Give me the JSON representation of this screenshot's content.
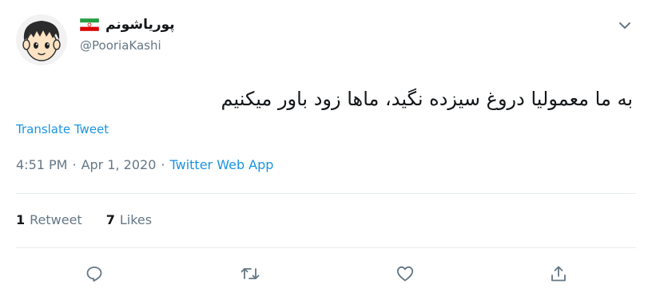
{
  "author": {
    "display_name": "پوریاشونم",
    "handle": "@PooriaKashi",
    "flag_icon": "iran-flag-icon",
    "avatar_icon": "cartoon-boy-avatar-icon"
  },
  "tweet": {
    "text": "به ما معمولیا دروغ سیزده نگید، ماها زود باور میکنیم",
    "translate_label": "Translate Tweet",
    "time": "4:51 PM",
    "separator": "·",
    "date": "Apr 1, 2020",
    "source": "Twitter Web App"
  },
  "stats": {
    "retweets": {
      "count": "1",
      "label": "Retweet"
    },
    "likes": {
      "count": "7",
      "label": "Likes"
    }
  },
  "actions": {
    "icons": [
      "reply-icon",
      "retweet-icon",
      "like-icon",
      "share-icon"
    ]
  },
  "colors": {
    "link": "#1b95e0",
    "secondary_text": "#657786",
    "primary_text": "#14171a",
    "divider": "#e6ecf0"
  }
}
